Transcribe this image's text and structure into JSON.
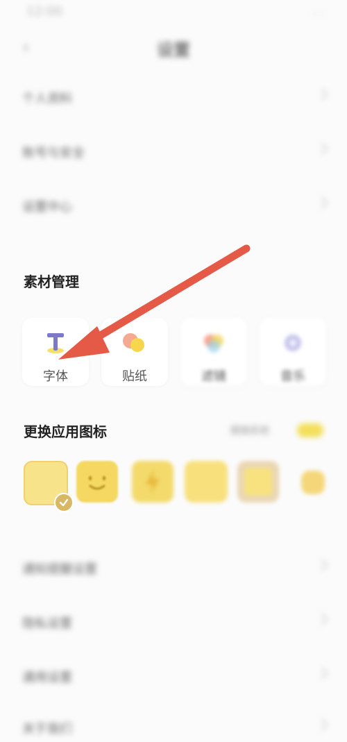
{
  "status_bar": {
    "time": "12:00",
    "right_info": "..."
  },
  "header": {
    "title": "设置"
  },
  "settings_top": [
    {
      "label": "个人资料"
    },
    {
      "label": "账号与安全"
    },
    {
      "label": "设置中心"
    }
  ],
  "material_section": {
    "title": "素材管理",
    "items": [
      {
        "label": "字体",
        "icon": "font-icon"
      },
      {
        "label": "贴纸",
        "icon": "sticker-icon"
      },
      {
        "label": "滤镜",
        "icon": "filter-icon"
      },
      {
        "label": "音乐",
        "icon": "music-icon"
      }
    ]
  },
  "app_icon_section": {
    "title": "更换应用图标",
    "toggle_label": "跟随系统",
    "selected_index": 0,
    "icons": [
      {
        "name": "icon-plain",
        "color": "#f7e389"
      },
      {
        "name": "icon-smile",
        "color": "#f4d862"
      },
      {
        "name": "icon-bolt",
        "color": "#f3da6a"
      },
      {
        "name": "icon-yellow",
        "color": "#f8e07c"
      },
      {
        "name": "icon-framed",
        "color": "#ead7b4"
      },
      {
        "name": "icon-partial",
        "color": "#f5d77a"
      }
    ]
  },
  "settings_bottom": [
    {
      "label": "通知提醒设置"
    },
    {
      "label": "隐私设置"
    },
    {
      "label": "通用设置"
    },
    {
      "label": "关于我们"
    }
  ],
  "colors": {
    "arrow": "#e55a47",
    "accent_yellow": "#f3d35c"
  }
}
